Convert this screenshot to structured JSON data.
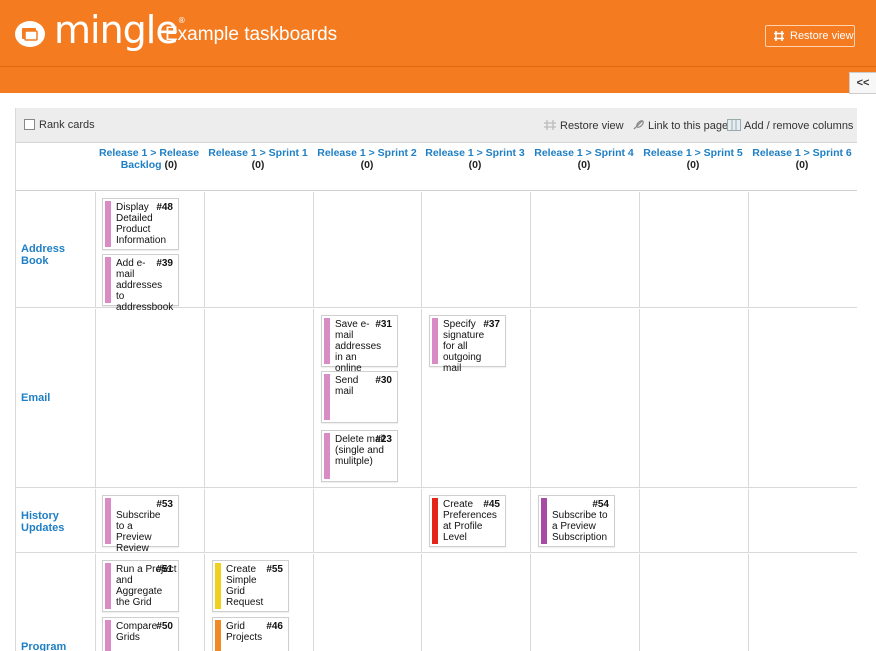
{
  "header": {
    "brand": "mingle",
    "brand_mark": "®",
    "title": "Example taskboards",
    "restore_view": "Restore view",
    "collapse": "<<"
  },
  "toolbar": {
    "rank_cards": "Rank cards",
    "restore_view": "Restore view",
    "link_page": "Link to this page",
    "add_remove": "Add / remove columns"
  },
  "colors": {
    "brand_orange": "#f47b20",
    "link_blue": "#1f7fc4",
    "stripe_pink": "#d98bc6",
    "stripe_red": "#e3261b",
    "stripe_purple": "#a64ca6",
    "stripe_yellow": "#f0d21e",
    "stripe_orange": "#f08a24"
  },
  "columns": [
    {
      "label": "Release 1 > Release Backlog",
      "count": "(0)"
    },
    {
      "label": "Release 1 > Sprint 1",
      "count": "(0)"
    },
    {
      "label": "Release 1 > Sprint 2",
      "count": "(0)"
    },
    {
      "label": "Release 1 > Sprint 3",
      "count": "(0)"
    },
    {
      "label": "Release 1 > Sprint 4",
      "count": "(0)"
    },
    {
      "label": "Release 1 > Sprint 5",
      "count": "(0)"
    },
    {
      "label": "Release 1 > Sprint 6",
      "count": "(0)"
    }
  ],
  "rows": [
    {
      "label": "Address Book"
    },
    {
      "label": "Email"
    },
    {
      "label": "History Updates"
    },
    {
      "label": "Program Rollup"
    }
  ],
  "cards": {
    "c48": {
      "num": "#48",
      "title": "Display Detailed Product Information",
      "color": "#d98bc6"
    },
    "c39": {
      "num": "#39",
      "title": "Add e-mail addresses to addressbook",
      "color": "#d98bc6"
    },
    "c31": {
      "num": "#31",
      "title": "Save e-mail addresses in an online",
      "color": "#d98bc6"
    },
    "c30": {
      "num": "#30",
      "title": "Send mail",
      "color": "#d98bc6"
    },
    "c23": {
      "num": "#23",
      "title": "Delete mail (single and mulitple)",
      "color": "#d98bc6"
    },
    "c37": {
      "num": "#37",
      "title": "Specify signature for all outgoing mail",
      "color": "#d98bc6"
    },
    "c53": {
      "num": "#53",
      "title": "Subscribe to a Preview Review",
      "color": "#d98bc6"
    },
    "c45": {
      "num": "#45",
      "title": "Create Preferences at Profile Level",
      "color": "#e3261b"
    },
    "c54": {
      "num": "#54",
      "title": "Subscribe to a Preview Subscription",
      "color": "#a64ca6"
    },
    "c51": {
      "num": "#51",
      "title": "Run a Project and Aggregate the Grid",
      "color": "#d98bc6"
    },
    "c50": {
      "num": "#50",
      "title": "Compare Grids",
      "color": "#d98bc6"
    },
    "c55": {
      "num": "#55",
      "title": "Create Simple Grid Request",
      "color": "#f0d21e"
    },
    "c46": {
      "num": "#46",
      "title": "Grid Projects",
      "color": "#f08a24"
    }
  }
}
